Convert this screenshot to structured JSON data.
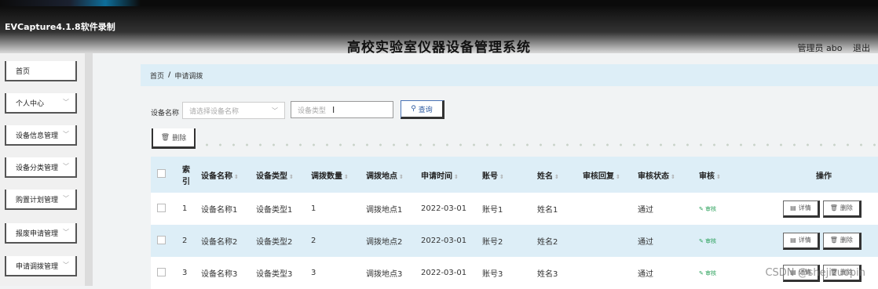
{
  "header": {
    "recording_label": "EVCapture4.1.8软件录制",
    "app_title": "高校实验室仪器设备管理系统",
    "user_label": "管理员 abo",
    "logout_label": "退出"
  },
  "sidebar": {
    "items": [
      {
        "label": "首页",
        "has_chevron": false
      },
      {
        "label": "个人中心",
        "has_chevron": true
      },
      {
        "label": "设备信息管理",
        "has_chevron": true
      },
      {
        "label": "设备分类管理",
        "has_chevron": true
      },
      {
        "label": "购置计划管理",
        "has_chevron": true
      },
      {
        "label": "报废申请管理",
        "has_chevron": true
      },
      {
        "label": "申请调拨管理",
        "has_chevron": true
      }
    ]
  },
  "breadcrumb": {
    "home": "首页",
    "separator": "/",
    "current": "申请调拨"
  },
  "search": {
    "label": "设备名称",
    "name_placeholder": "请选择设备名称",
    "type_placeholder": "设备类型",
    "search_button": "查询"
  },
  "toolbar": {
    "delete_label": "删除"
  },
  "table": {
    "headers": [
      "索引",
      "设备名称",
      "设备类型",
      "调拨数量",
      "调拨地点",
      "申请时间",
      "账号",
      "姓名",
      "审核回复",
      "审核状态",
      "审核",
      "操作"
    ],
    "rows": [
      {
        "index": "1",
        "name": "设备名称1",
        "type": "设备类型1",
        "qty": "1",
        "place": "调拨地点1",
        "date": "2022-03-01",
        "account": "账号1",
        "person": "姓名1",
        "reply": "",
        "status": "通过",
        "audit": "审核"
      },
      {
        "index": "2",
        "name": "设备名称2",
        "type": "设备类型2",
        "qty": "2",
        "place": "调拨地点2",
        "date": "2022-03-01",
        "account": "账号2",
        "person": "姓名2",
        "reply": "",
        "status": "通过",
        "audit": "审核"
      },
      {
        "index": "3",
        "name": "设备名称3",
        "type": "设备类型3",
        "qty": "3",
        "place": "调拨地点3",
        "date": "2022-03-01",
        "account": "账号3",
        "person": "姓名3",
        "reply": "",
        "status": "通过",
        "audit": "审核"
      }
    ],
    "detail_label": "详情",
    "delete_label": "删除"
  },
  "watermark": "CSDN @shejizuopin"
}
